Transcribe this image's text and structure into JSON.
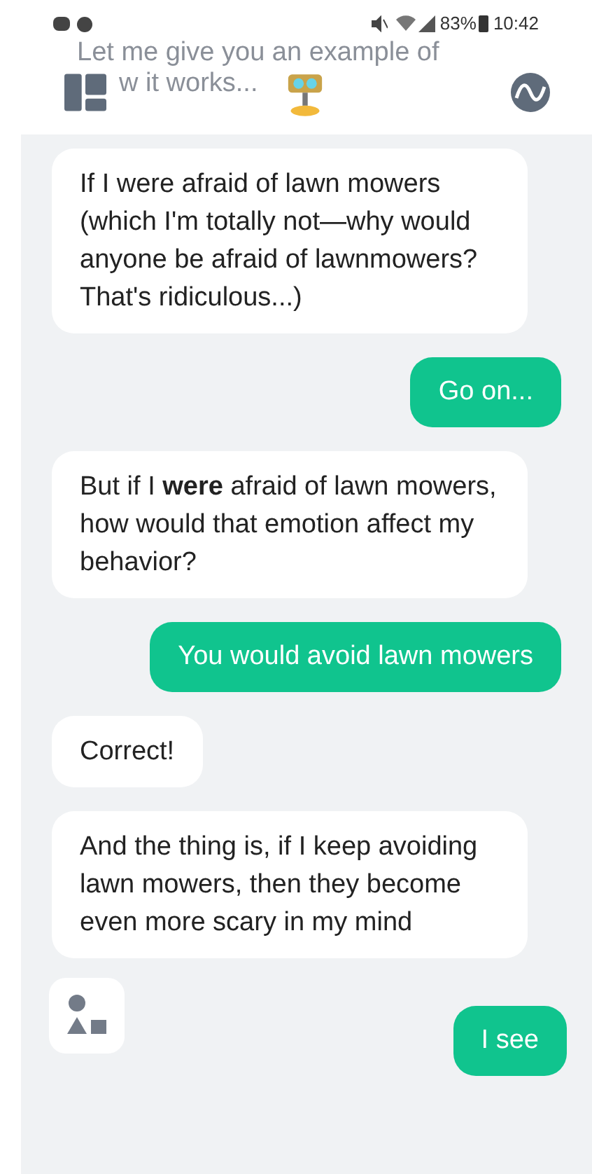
{
  "status_bar": {
    "battery": "83%",
    "time": "10:42"
  },
  "faded_message": [
    "Let me give you an example of",
    "w it works..."
  ],
  "messages": [
    {
      "kind": "bot",
      "text": "If I were afraid of lawn mowers (which I'm totally not—why would anyone be afraid of lawnmowers? That's ridiculous...)"
    },
    {
      "kind": "user",
      "text": "Go on..."
    },
    {
      "kind": "bot",
      "text": "But if I **were** afraid of lawn mowers, how would that emotion affect my behavior?"
    },
    {
      "kind": "user",
      "text": "You would avoid lawn mowers"
    },
    {
      "kind": "bot",
      "text": "Correct!"
    },
    {
      "kind": "bot",
      "text": "And the thing is, if I keep avoiding lawn mowers, then they become even more scary in my mind"
    },
    {
      "kind": "user",
      "text": "I see"
    }
  ]
}
